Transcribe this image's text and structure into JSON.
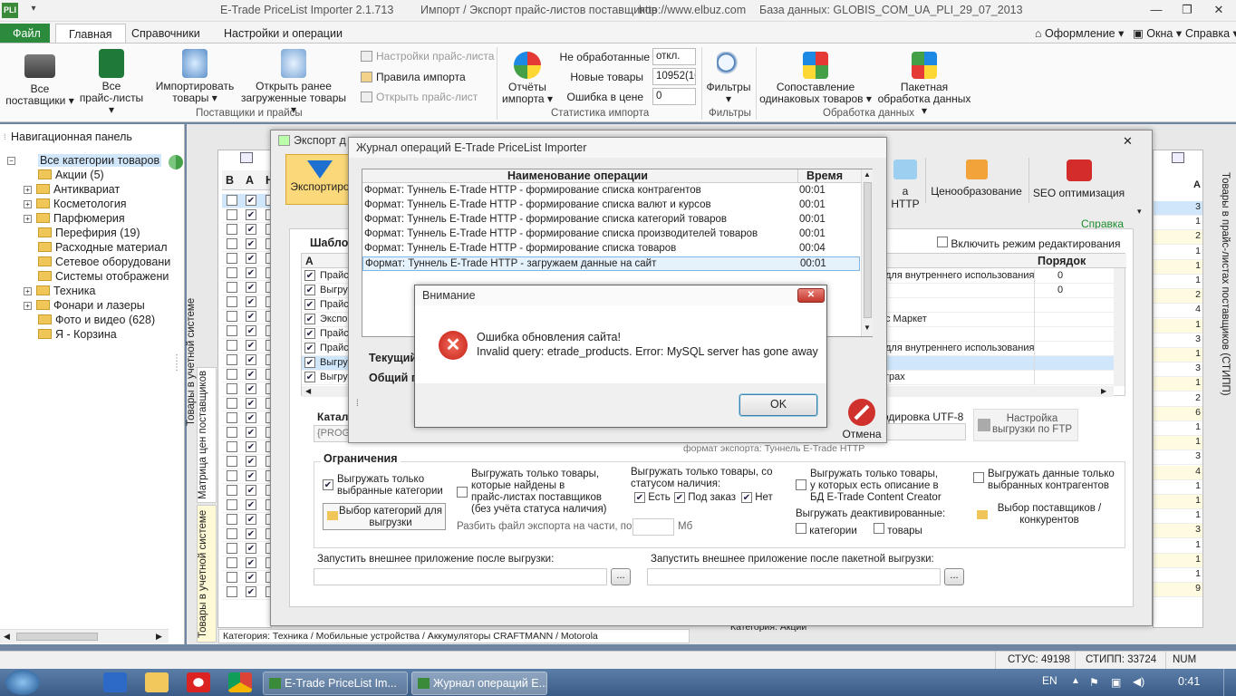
{
  "titlebar": {
    "app_title": "E-Trade PriceList Importer 2.1.713",
    "subtitle": "Импорт / Экспорт прайс-листов поставщиков",
    "url": "http://www.elbuz.com",
    "db": "База данных: GLOBIS_COM_UA_PLI_29_07_2013",
    "logo": "PLI"
  },
  "tabs": {
    "file": "Файл",
    "home": "Главная",
    "refs": "Справочники",
    "settings": "Настройки и операции",
    "design": "Оформление",
    "windows": "Окна",
    "help": "Справка"
  },
  "ribbon": {
    "all_suppliers": [
      "Все",
      "поставщики"
    ],
    "all_pricelists": [
      "Все",
      "прайс-листы"
    ],
    "import_goods": [
      "Импортировать",
      "товары"
    ],
    "open_loaded": [
      "Открыть ранее",
      "загруженные товары"
    ],
    "pl_settings": "Настройки прайс-листа",
    "import_rules": "Правила импорта",
    "open_pl": "Открыть прайс-лист",
    "group_suppliers": "Поставщики и прайсы",
    "reports": [
      "Отчёты",
      "импорта"
    ],
    "stat_unprocessed_lbl": "Не обработанные",
    "stat_unprocessed_val": "откл.",
    "stat_new_lbl": "Новые товары",
    "stat_new_val": "10952(10",
    "stat_err_lbl": "Ошибка в цене",
    "stat_err_val": "0",
    "group_stats": "Статистика импорта",
    "filters": "Фильтры",
    "group_filters": "Фильтры",
    "match": [
      "Сопоставление",
      "одинаковых товаров"
    ],
    "batch": [
      "Пакетная",
      "обработка данных"
    ],
    "group_processing": "Обработка данных"
  },
  "nav": {
    "title": "Навигационная панель",
    "root": "Все категории товаров",
    "items": [
      {
        "label": "Акции (5)",
        "exp": false
      },
      {
        "label": "Антиквариат",
        "exp": true
      },
      {
        "label": "Косметология",
        "exp": true
      },
      {
        "label": "Парфюмерия",
        "exp": true
      },
      {
        "label": "Перефирия (19)",
        "exp": false
      },
      {
        "label": "Расходные материал",
        "exp": false
      },
      {
        "label": "Сетевое оборудовани",
        "exp": false
      },
      {
        "label": "Системы отображени",
        "exp": false
      },
      {
        "label": "Техника",
        "exp": true
      },
      {
        "label": "Фонари и лазеры",
        "exp": true
      },
      {
        "label": "Фото и видео (628)",
        "exp": false
      },
      {
        "label": "Я - Корзина",
        "exp": false
      }
    ],
    "vtab_matrix": "Матрица цен поставщиков",
    "vtab_goods": "Товары в учетной системе",
    "vtab_goods2": "Товары в учетной системе",
    "category_path": "Категория: Техника / Мобильные устройства / Аккумуляторы CRAFTMANN / Motorola"
  },
  "grid": {
    "headers": [
      "В",
      "А",
      "Н"
    ]
  },
  "right": {
    "vtab": "Товары в прайс-листах поставщиков (СТИПП)",
    "col_a": "А",
    "nums": [
      "3",
      "1",
      "2",
      "1",
      "1",
      "1",
      "2",
      "4",
      "1",
      "3",
      "1",
      "3",
      "1",
      "2",
      "6",
      "1",
      "1",
      "3",
      "4",
      "1",
      "1",
      "1",
      "3",
      "1",
      "1",
      "1",
      "9"
    ],
    "category_bottom": "Категория: Акции"
  },
  "export": {
    "title": "Экспорт д",
    "btn_export": "Экспортиро",
    "btn_http": "а HTTP",
    "btn_pricing": "Ценообразование",
    "btn_seo": "SEO оптимизация",
    "help_link": "Справка",
    "templates": "Шаблон",
    "edit_mode": "Включить режим редактирования",
    "col_a": "А",
    "col_order": "Порядок",
    "rows_left": [
      "Прайс",
      "Выгру",
      "Прайс",
      "Экспор",
      "Прайс",
      "Прайс",
      "Выгру",
      "Выгру"
    ],
    "rows_right": [
      "для внутреннего использования",
      "",
      "",
      "с Маркет",
      "",
      "для внутреннего использования",
      "",
      "грах"
    ],
    "orders": [
      "0",
      "0"
    ],
    "current": "Текущий",
    "total": "Общий п",
    "catalog_lbl": "Катало",
    "catalog_val": "{PROGR",
    "encoding": "одировка UTF-8",
    "ftp": [
      "Настройка",
      "выгрузки по FTP"
    ],
    "export_format": "формат экспорта: Туннель E-Trade HTTP",
    "limits": "Ограничения",
    "only_selected_cats": [
      "Выгружать только",
      "выбранные категории"
    ],
    "choose_cats": [
      "Выбор категорий для",
      "выгрузки"
    ],
    "only_found": [
      "Выгружать только товары,",
      "которые найдены в",
      "прайс-листах поставщиков",
      "(без учёта статуса наличия)"
    ],
    "split_lbl": "Разбить файл экспорта на части, по:",
    "split_unit": "Мб",
    "only_status": [
      "Выгружать только товары, со",
      "статусом наличия:"
    ],
    "status_yes": "Есть",
    "status_order": "Под заказ",
    "status_no": "Нет",
    "only_desc": [
      "Выгружать только товары,",
      "у которых есть описание в",
      "БД E-Trade Content Creator"
    ],
    "deactivated": "Выгружать деактивированные:",
    "deact_cats": "категории",
    "deact_goods": "товары",
    "only_competitors": [
      "Выгружать данные только",
      "выбранных контрагентов"
    ],
    "choose_suppliers": [
      "Выбор поставщиков /",
      "конкурентов"
    ],
    "run_after": "Запустить внешнее приложение после выгрузки:",
    "run_after_batch": "Запустить внешнее приложение после пакетной выгрузки:",
    "dots": "...",
    "cancel": "Отмена"
  },
  "log": {
    "title": "Журнал операций E-Trade PriceList Importer",
    "col_name": "Наименование операции",
    "col_time": "Время",
    "rows": [
      {
        "name": "Формат: Туннель E-Trade HTTP - формирование списка контрагентов",
        "time": "00:01"
      },
      {
        "name": "Формат: Туннель E-Trade HTTP - формирование списка валют и курсов",
        "time": "00:01"
      },
      {
        "name": "Формат: Туннель E-Trade HTTP - формирование списка категорий товаров",
        "time": "00:01"
      },
      {
        "name": "Формат: Туннель E-Trade HTTP - формирование списка производителей товаров",
        "time": "00:01"
      },
      {
        "name": "Формат: Туннель E-Trade HTTP - формирование списка товаров",
        "time": "00:04"
      },
      {
        "name": "Формат: Туннель E-Trade HTTP - загружаем данные на сайт",
        "time": "00:01"
      }
    ]
  },
  "alert": {
    "title": "Внимание",
    "line1": "Ошибка обновления сайта!",
    "line2": "Invalid query: etrade_products. Error: MySQL server has gone away",
    "ok": "OK"
  },
  "status": {
    "stus": "СТУС: 49198",
    "stipp": "СТИПП: 33724",
    "num": "NUM"
  },
  "taskbar": {
    "task1": "E-Trade PriceList Im...",
    "task2": "Журнал операций E...",
    "lang": "EN",
    "time": "0:41"
  },
  "colors": {
    "accent_green": "#2c8a3c",
    "selection": "#cfe6fb",
    "error_red": "#d0312d"
  }
}
